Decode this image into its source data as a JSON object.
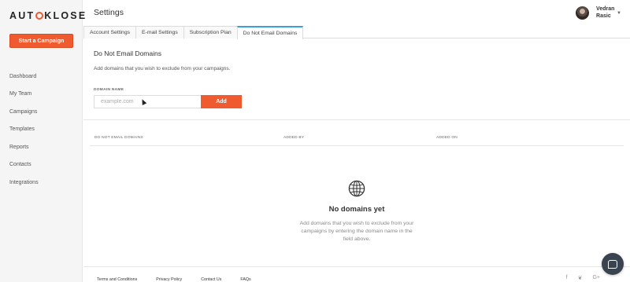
{
  "brand": {
    "logo_left": "AUT",
    "logo_right": "KLOSE",
    "accent_color": "#ef5a2f"
  },
  "sidebar": {
    "cta_label": "Start a Campaign",
    "items": [
      {
        "label": "Dashboard"
      },
      {
        "label": "My Team"
      },
      {
        "label": "Campaigns"
      },
      {
        "label": "Templates"
      },
      {
        "label": "Reports"
      },
      {
        "label": "Contacts"
      },
      {
        "label": "Integrations"
      }
    ]
  },
  "header": {
    "title": "Settings",
    "user": {
      "name": "Vedran Rasic",
      "menu_icon": "chevron-down-icon"
    }
  },
  "tabs": [
    {
      "label": "Account Settings",
      "active": false
    },
    {
      "label": "E-mail Settings",
      "active": false
    },
    {
      "label": "Subscription Plan",
      "active": false
    },
    {
      "label": "Do Not Email Domains",
      "active": true
    }
  ],
  "section": {
    "title": "Do Not Email Domains",
    "description": "Add domains that you wish to exclude from your campaigns.",
    "field_label": "DOMAIN NAME",
    "field_value": "",
    "field_placeholder": "example.com",
    "add_label": "Add"
  },
  "table": {
    "columns": [
      "DO NOT EMAIL DOMAINS",
      "ADDED BY",
      "ADDED ON"
    ]
  },
  "empty_state": {
    "icon": "globe-icon",
    "title": "No domains yet",
    "description": "Add domains that you wish to exclude from your campaigns by entering the domain name in the field above."
  },
  "footer": {
    "links": [
      "Terms and Conditions",
      "Privacy Policy",
      "Contact Us",
      "FAQs"
    ],
    "social": [
      "f",
      "❦",
      "G+"
    ]
  }
}
